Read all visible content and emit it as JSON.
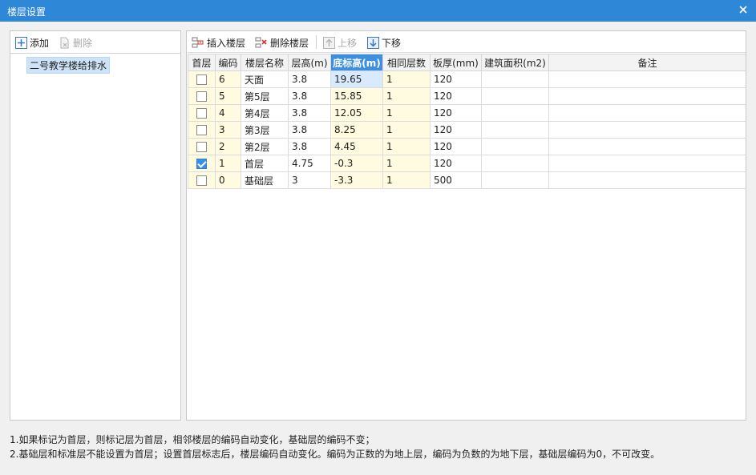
{
  "window": {
    "title": "楼层设置"
  },
  "left_toolbar": {
    "add_label": "添加",
    "delete_label": "删除"
  },
  "tree": {
    "project_name": "二号教学楼给排水"
  },
  "right_toolbar": {
    "insert_label": "插入楼层",
    "delete_label": "删除楼层",
    "move_up_label": "上移",
    "move_down_label": "下移"
  },
  "grid": {
    "columns": [
      "首层",
      "编码",
      "楼层名称",
      "层高(m)",
      "底标高(m)",
      "相同层数",
      "板厚(mm)",
      "建筑面积(m2)",
      "备注"
    ],
    "rows": [
      {
        "checked": false,
        "code": "6",
        "name": "天面",
        "height": "3.8",
        "base": "19.65",
        "same": "1",
        "slab": "120",
        "area": "",
        "note": ""
      },
      {
        "checked": false,
        "code": "5",
        "name": "第5层",
        "height": "3.8",
        "base": "15.85",
        "same": "1",
        "slab": "120",
        "area": "",
        "note": ""
      },
      {
        "checked": false,
        "code": "4",
        "name": "第4层",
        "height": "3.8",
        "base": "12.05",
        "same": "1",
        "slab": "120",
        "area": "",
        "note": ""
      },
      {
        "checked": false,
        "code": "3",
        "name": "第3层",
        "height": "3.8",
        "base": "8.25",
        "same": "1",
        "slab": "120",
        "area": "",
        "note": ""
      },
      {
        "checked": false,
        "code": "2",
        "name": "第2层",
        "height": "3.8",
        "base": "4.45",
        "same": "1",
        "slab": "120",
        "area": "",
        "note": ""
      },
      {
        "checked": true,
        "code": "1",
        "name": "首层",
        "height": "4.75",
        "base": "-0.3",
        "same": "1",
        "slab": "120",
        "area": "",
        "note": ""
      },
      {
        "checked": false,
        "code": "0",
        "name": "基础层",
        "height": "3",
        "base": "-3.3",
        "same": "1",
        "slab": "500",
        "area": "",
        "note": ""
      }
    ]
  },
  "notes": {
    "line1": "1.如果标记为首层，则标记层为首层，相邻楼层的编码自动变化，基础层的编码不变；",
    "line2": "2.基础层和标准层不能设置为首层；设置首层标志后，楼层编码自动变化。编码为正数的为地上层，编码为负数的为地下层，基础层编码为0，不可改变。"
  },
  "colors": {
    "titlebar": "#2f87d8",
    "selected_header": "#3d8fe0",
    "yellow_cell": "#fefbe0",
    "selection": "#cfe3f8"
  }
}
